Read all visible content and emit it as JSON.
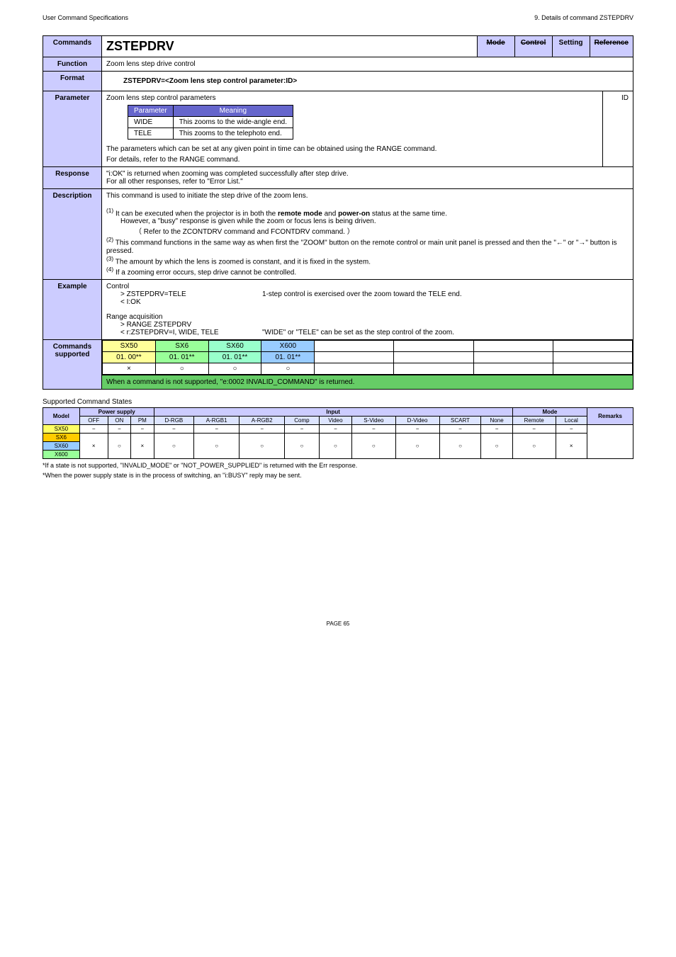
{
  "header": {
    "left": "User Command Specifications",
    "right": "9. Details of command ZSTEPDRV"
  },
  "main": {
    "commands_label": "Commands",
    "command_name": "ZSTEPDRV",
    "mode_label": "Mode",
    "control_label": "Control",
    "setting_label": "Setting",
    "reference_label": "Reference",
    "function_label": "Function",
    "function_text": "Zoom lens step drive control",
    "format_label": "Format",
    "format_text": "ZSTEPDRV=<Zoom lens step control parameter:ID>",
    "parameter_label": "Parameter",
    "parameter_intro": "Zoom lens step control parameters",
    "param_header1": "Parameter",
    "param_header2": "Meaning",
    "param_rows": [
      {
        "p": "WIDE",
        "m": "This zooms to the wide-angle end."
      },
      {
        "p": "TELE",
        "m": "This zooms to the telephoto end."
      }
    ],
    "param_text2": "The parameters which can be set at any given point in time can be obtained using the RANGE command.",
    "param_text3": "For details, refer to the RANGE command.",
    "id_label": "ID",
    "response_label": "Response",
    "response_text1": "\"i:OK\" is returned when zooming was completed successfully after step drive.",
    "response_text2": "For all other responses, refer to \"Error List.\"",
    "description_label": "Description",
    "desc_intro": "This command is used to initiate the step drive of the zoom lens.",
    "desc_1a": "It can be executed when the projector is in both the ",
    "desc_1_bold1": "remote mode",
    "desc_1b": " and ",
    "desc_1_bold2": "power-on",
    "desc_1c": " status at the same time.",
    "desc_1_sub1": "However, a \"busy\" response is given while the zoom or focus lens is being driven.",
    "desc_1_sub2": "（ Refer to the ZCONTDRV command and FCONTDRV command. ）",
    "desc_2": "This command functions in the same way as when first the \"ZOOM\" button on the remote control or main unit panel is pressed and then the \"←\" or \"→\" button is pressed.",
    "desc_3": "The amount by which the lens is zoomed is constant, and it is fixed in the system.",
    "desc_4": "If a zooming error occurs, step drive cannot be controlled.",
    "example_label": "Example",
    "ex_control": "Control",
    "ex_line1": "> ZSTEPDRV=TELE",
    "ex_line1_desc": "1-step control is exercised over the zoom toward the TELE end.",
    "ex_line2": "< I:OK",
    "ex_range": "Range acquisition",
    "ex_line3": "> RANGE ZSTEPDRV",
    "ex_line4": "< r:ZSTEPDRV=I, WIDE, TELE",
    "ex_line4_desc": "\"WIDE\" or \"TELE\" can be set as the step control of the zoom.",
    "cmds_label": "Commands supported",
    "models": [
      {
        "name": "SX50",
        "ver": "01. 00**"
      },
      {
        "name": "SX6",
        "ver": "01. 01**"
      },
      {
        "name": "SX60",
        "ver": "01. 01**"
      },
      {
        "name": "X600",
        "ver": "01. 01**"
      }
    ],
    "sym_x": "×",
    "sym_o": "○",
    "supported_note": "When a command is not supported, \"e:0002 INVALID_COMMAND\" is returned."
  },
  "states": {
    "title": "Supported Command States",
    "h_model": "Model",
    "h_power": "Power supply",
    "h_input": "Input",
    "h_mode": "Mode",
    "h_remarks": "Remarks",
    "s_off": "OFF",
    "s_on": "ON",
    "s_pm": "PM",
    "s_drgb": "D-RGB",
    "s_argb1": "A-RGB1",
    "s_argb2": "A-RGB2",
    "s_comp": "Comp",
    "s_video": "Video",
    "s_svideo": "S-Video",
    "s_dvideo": "D-Video",
    "s_scart": "SCART",
    "s_none": "None",
    "s_remote": "Remote",
    "s_local": "Local",
    "m_sx50": "SX50",
    "m_sx6": "SX6",
    "m_sx60": "SX60",
    "m_x600": "X600",
    "dash": "−",
    "x": "×",
    "o": "○"
  },
  "footnotes": {
    "f1": "*If a state is not supported, \"INVALID_MODE\" or \"NOT_POWER_SUPPLIED\" is returned with the Err response.",
    "f2": "*When the power supply state is in the process of switching, an \"i:BUSY\" reply may be sent."
  },
  "page": "PAGE 65"
}
